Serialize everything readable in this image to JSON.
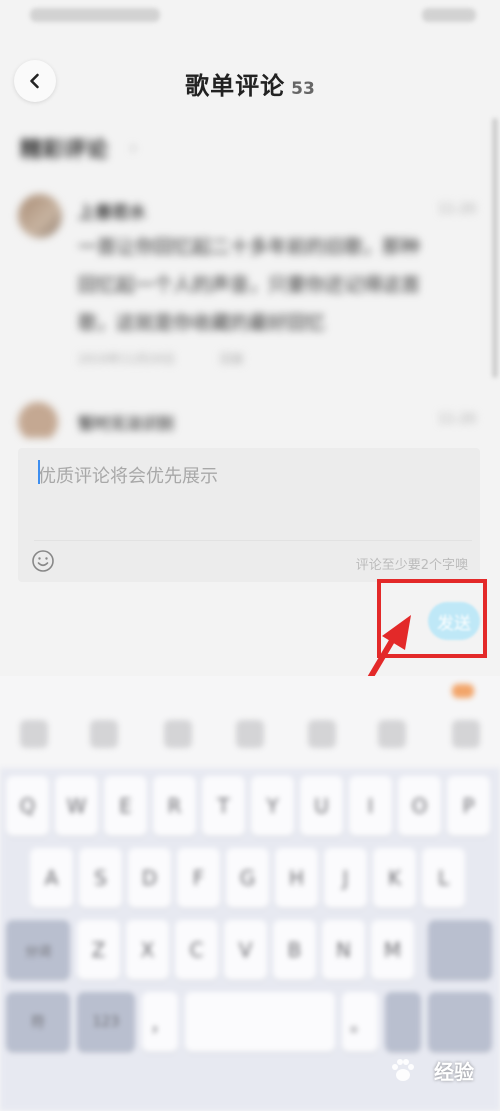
{
  "header": {
    "title": "歌单评论",
    "count": "53"
  },
  "blurred_content": {
    "section_title": "精彩评论",
    "comments": [
      {
        "user": "上善若水",
        "time": "11-20",
        "lines": [
          "一首让你回忆起二十多年前的旧歌，那种",
          "回忆起一个人的声音，只要你还记得这首",
          "歌，这就是你收藏的最好回忆"
        ],
        "meta": "2019年11月20日",
        "reply": "回复"
      },
      {
        "user": "暂时无法识别",
        "time": "11-20"
      }
    ]
  },
  "composer": {
    "placeholder": "优质评论将会优先展示",
    "hint": "评论至少要2个字噢",
    "emoji_icon": "smiley-icon",
    "send_label": "发送"
  },
  "keyboard": {
    "row1": [
      "Q",
      "W",
      "E",
      "R",
      "T",
      "Y",
      "U",
      "I",
      "O",
      "P"
    ],
    "row2": [
      "A",
      "S",
      "D",
      "F",
      "G",
      "H",
      "J",
      "K",
      "L"
    ],
    "row3": [
      "Z",
      "X",
      "C",
      "V",
      "B",
      "N",
      "M"
    ],
    "shift_label": "分词",
    "num_label": "符",
    "sym_label": "123"
  },
  "watermark": {
    "text": "经验"
  },
  "colors": {
    "annotation": "#e32929",
    "send_bg": "#bfe8f7",
    "caret": "#3d8ef0"
  }
}
